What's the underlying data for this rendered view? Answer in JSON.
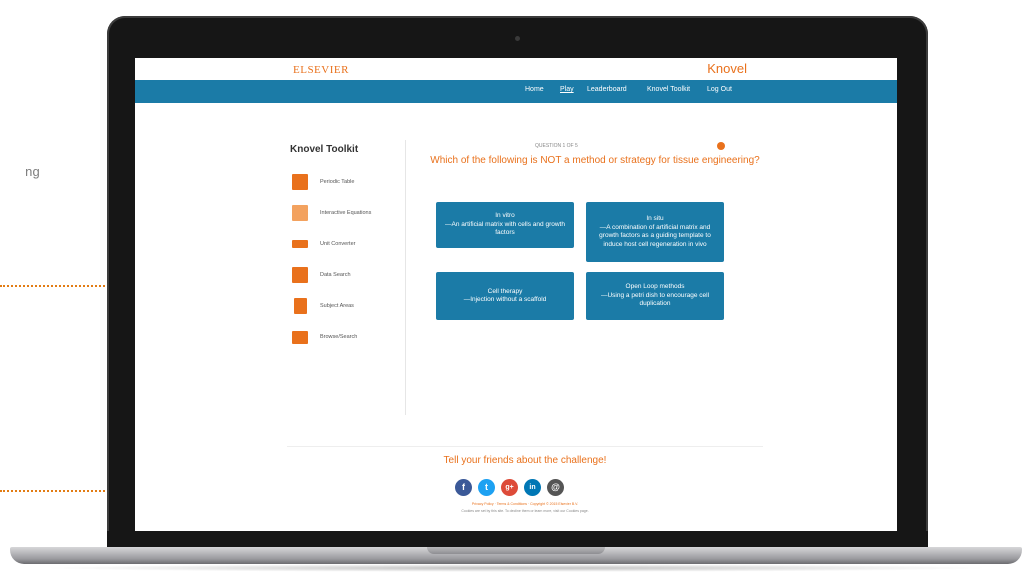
{
  "outside": {
    "side_text": "ng"
  },
  "header": {
    "brand_left": "ELSEVIER",
    "brand_right": "Knovel"
  },
  "nav": {
    "items": [
      "Home",
      "Play",
      "Leaderboard",
      "Knovel Toolkit",
      "Log Out"
    ]
  },
  "sidebar": {
    "title": "Knovel Toolkit",
    "items": [
      {
        "label": "Periodic Table",
        "icon": "periodic-table-icon"
      },
      {
        "label": "Interactive Equations",
        "icon": "equations-icon"
      },
      {
        "label": "Unit Converter",
        "icon": "unit-converter-icon"
      },
      {
        "label": "Data Search",
        "icon": "data-search-icon"
      },
      {
        "label": "Subject Areas",
        "icon": "subject-areas-icon"
      },
      {
        "label": "Browse/Search",
        "icon": "browse-folder-icon"
      }
    ]
  },
  "quiz": {
    "counter": "QUESTION 1 OF 5",
    "question": "Which of the following is NOT a method or strategy for tissue engineering?",
    "answers": [
      "In vitro\n—An artificial matrix with cells and growth factors",
      "In situ\n—A combination of artificial matrix and growth factors as a guiding template to induce host cell regeneration in vivo",
      "Cell therapy\n—Injection without a scaffold",
      "Open Loop methods\n—Using a petri dish to encourage cell duplication"
    ]
  },
  "footer": {
    "share_text": "Tell your friends about the challenge!",
    "social": [
      {
        "name": "facebook-icon",
        "glyph": "f",
        "color": "#3b5998"
      },
      {
        "name": "twitter-icon",
        "glyph": "t",
        "color": "#1da1f2"
      },
      {
        "name": "google-plus-icon",
        "glyph": "g+",
        "color": "#dd4b39"
      },
      {
        "name": "linkedin-icon",
        "glyph": "in",
        "color": "#0077b5"
      },
      {
        "name": "email-icon",
        "glyph": "@",
        "color": "#555555"
      }
    ],
    "links_line": "Privacy Policy · Terms & Conditions · Copyright © 2015 Elsevier B.V.",
    "small_print": "Cookies are set by this site. To decline them or learn more, visit our Cookies page."
  },
  "colors": {
    "accent": "#e9711c",
    "nav_blue": "#1b7ba7"
  }
}
